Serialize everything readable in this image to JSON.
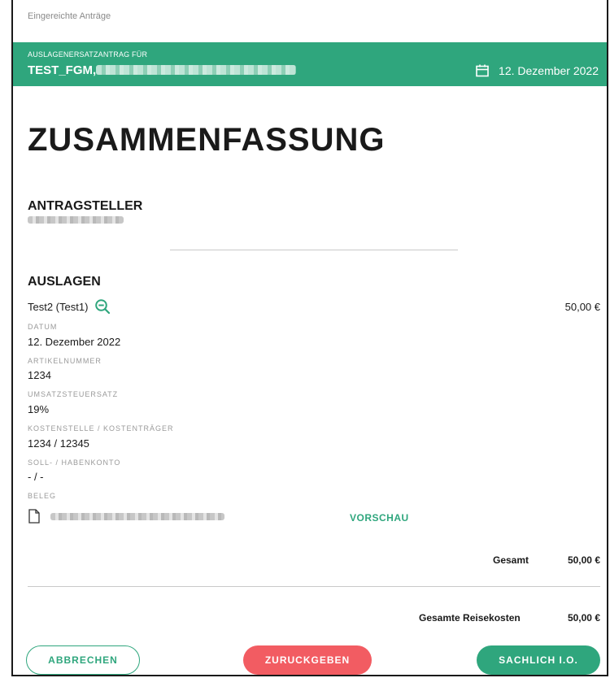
{
  "breadcrumb": "Eingereichte Anträge",
  "banner": {
    "subtitle": "AUSLAGENERSATZANTRAG FÜR",
    "name": "TEST_FGM,",
    "date": "12. Dezember 2022"
  },
  "title": "ZUSAMMENFASSUNG",
  "applicant": {
    "heading": "ANTRAGSTELLER"
  },
  "expenses": {
    "heading": "AUSLAGEN",
    "item_name": "Test2 (Test1)",
    "item_amount": "50,00 €",
    "fields": [
      {
        "label": "DATUM",
        "value": "12. Dezember 2022"
      },
      {
        "label": "ARTIKELNUMMER",
        "value": "1234"
      },
      {
        "label": "UMSATZSTEUERSATZ",
        "value": "19%"
      },
      {
        "label": "KOSTENSTELLE / KOSTENTRÄGER",
        "value": "1234 / 12345"
      },
      {
        "label": "SOLL- / HABENKONTO",
        "value": "- / -"
      }
    ],
    "receipt_label": "BELEG",
    "preview_label": "VORSCHAU",
    "total_label": "Gesamt",
    "total_value": "50,00 €"
  },
  "grand_total": {
    "label": "Gesamte Reisekosten",
    "value": "50,00 €"
  },
  "actions": {
    "cancel": "ABBRECHEN",
    "return": "ZURUCKGEBEN",
    "approve": "SACHLICH I.O."
  },
  "colors": {
    "accent": "#2fa67d",
    "danger": "#f25c62"
  }
}
